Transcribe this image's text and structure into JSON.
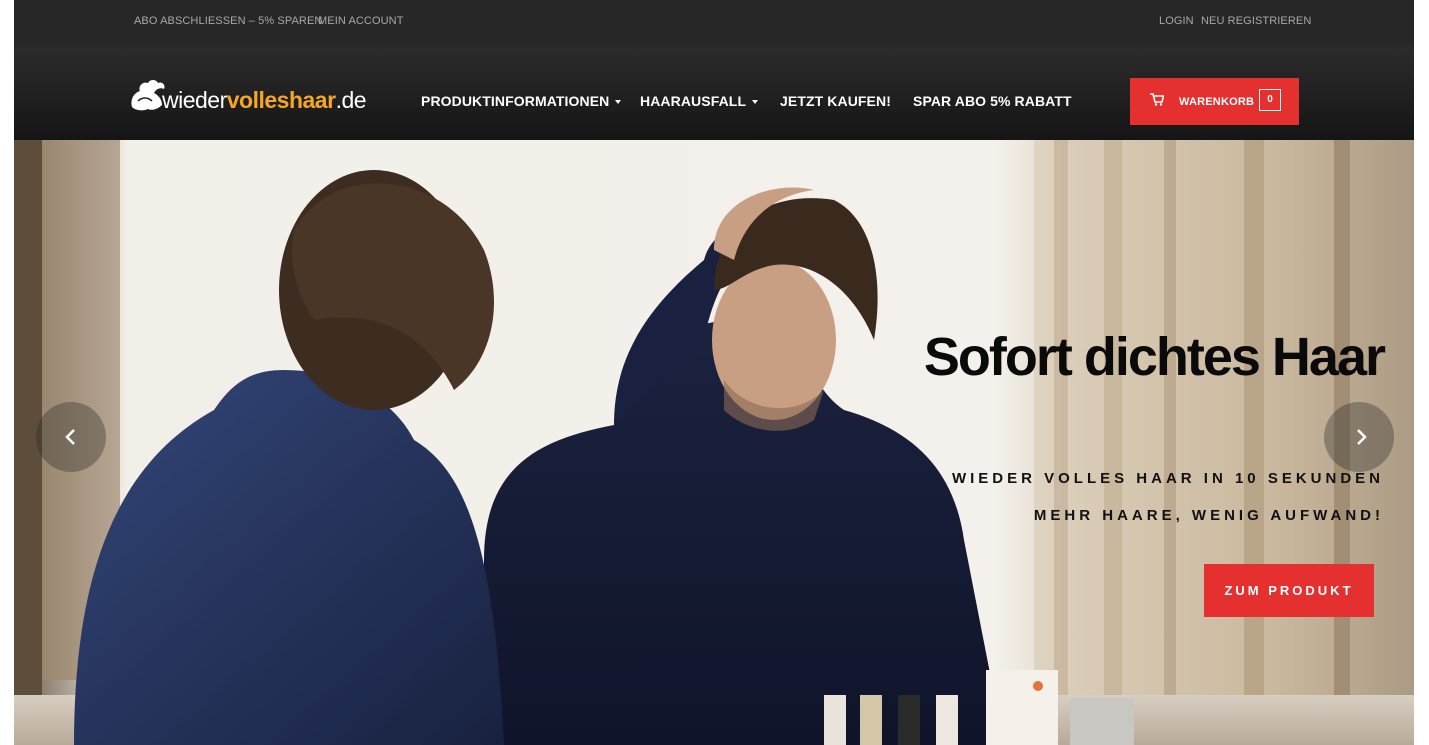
{
  "topbar": {
    "abo_link": "ABO ABSCHLIESSEN – 5% SPAREN",
    "account_link": "MEIN ACCOUNT",
    "login_link": "LOGIN",
    "register_link": "NEU REGISTRIEREN"
  },
  "header": {
    "logo": {
      "part1": "wieder",
      "part2": "volleshaar",
      "part3": ".de"
    },
    "nav": [
      {
        "label": "PRODUKTINFORMATIONEN",
        "dropdown": true
      },
      {
        "label": "HAARAUSFALL",
        "dropdown": true
      },
      {
        "label": "JETZT KAUFEN!",
        "dropdown": false
      },
      {
        "label": "SPAR ABO 5% RABATT",
        "dropdown": false
      }
    ],
    "cart": {
      "label": "WARENKORB",
      "count": "0",
      "icon": "cart-icon"
    }
  },
  "hero": {
    "headline": "Sofort dichtes Haar",
    "subline1": "WIEDER VOLLES HAAR IN 10 SEKUNDEN",
    "subline2": "MEHR HAARE, WENIG AUFWAND!",
    "cta": "ZUM PRODUKT",
    "prev_icon": "chevron-left-icon",
    "next_icon": "chevron-right-icon"
  },
  "colors": {
    "accent": "#e53030",
    "topbar_bg": "#272727",
    "header_bg": "#1f1f1f",
    "logo_accent": "#f5a623"
  }
}
